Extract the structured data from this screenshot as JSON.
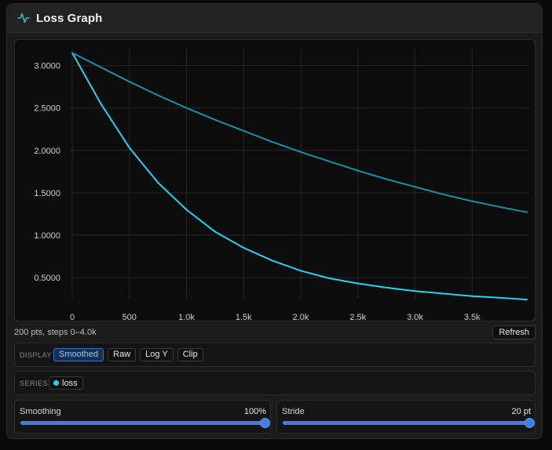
{
  "panel": {
    "title": "Loss Graph",
    "icon": "activity-pulse-icon",
    "accent": "#22c3a6"
  },
  "chart_data": {
    "type": "line",
    "title": "",
    "xlabel": "",
    "ylabel": "",
    "xlim": [
      0,
      4000
    ],
    "ylim": [
      0.25,
      3.2
    ],
    "grid": true,
    "x_ticks": [
      {
        "value": 0,
        "label": "0"
      },
      {
        "value": 500,
        "label": "500"
      },
      {
        "value": 1000,
        "label": "1.0k"
      },
      {
        "value": 1500,
        "label": "1.5k"
      },
      {
        "value": 2000,
        "label": "2.0k"
      },
      {
        "value": 2500,
        "label": "2.5k"
      },
      {
        "value": 3000,
        "label": "3.0k"
      },
      {
        "value": 3500,
        "label": "3.5k"
      }
    ],
    "y_ticks": [
      {
        "value": 3.0,
        "label": "3.0000"
      },
      {
        "value": 2.5,
        "label": "2.5000"
      },
      {
        "value": 2.0,
        "label": "2.0000"
      },
      {
        "value": 1.5,
        "label": "1.5000"
      },
      {
        "value": 1.0,
        "label": "1.0000"
      },
      {
        "value": 0.5,
        "label": "0.5000"
      }
    ],
    "series": [
      {
        "name": "loss",
        "color": "#22d3ee",
        "x": [
          0,
          250,
          500,
          750,
          1000,
          1250,
          1500,
          1750,
          2000,
          2250,
          2500,
          2750,
          3000,
          3250,
          3500,
          3750,
          3980
        ],
        "y": [
          3.15,
          2.55,
          2.03,
          1.62,
          1.3,
          1.04,
          0.85,
          0.7,
          0.58,
          0.49,
          0.43,
          0.38,
          0.34,
          0.31,
          0.28,
          0.26,
          0.24
        ]
      },
      {
        "color": "#1a8fa3",
        "x": [
          0,
          250,
          500,
          750,
          1000,
          1250,
          1500,
          1750,
          2000,
          2250,
          2500,
          2750,
          3000,
          3250,
          3500,
          3750,
          3980
        ],
        "y": [
          3.15,
          2.98,
          2.81,
          2.65,
          2.5,
          2.36,
          2.23,
          2.1,
          1.98,
          1.87,
          1.76,
          1.66,
          1.57,
          1.48,
          1.4,
          1.33,
          1.27
        ]
      }
    ]
  },
  "info": {
    "summary": "200 pts, steps 0–4.0k",
    "refresh_label": "Refresh"
  },
  "display": {
    "label": "DISPLAY",
    "chips": [
      {
        "label": "Smoothed",
        "active": true
      },
      {
        "label": "Raw",
        "active": false
      },
      {
        "label": "Log Y",
        "active": false
      },
      {
        "label": "Clip",
        "active": false
      }
    ]
  },
  "series_section": {
    "label": "SERIES",
    "items": [
      {
        "label": "loss",
        "color": "#22d3ee"
      }
    ]
  },
  "sliders": {
    "smoothing": {
      "label": "Smoothing",
      "value_text": "100%",
      "fraction": 1.0
    },
    "stride": {
      "label": "Stride",
      "value_text": "20 pt",
      "fraction": 1.0
    }
  }
}
